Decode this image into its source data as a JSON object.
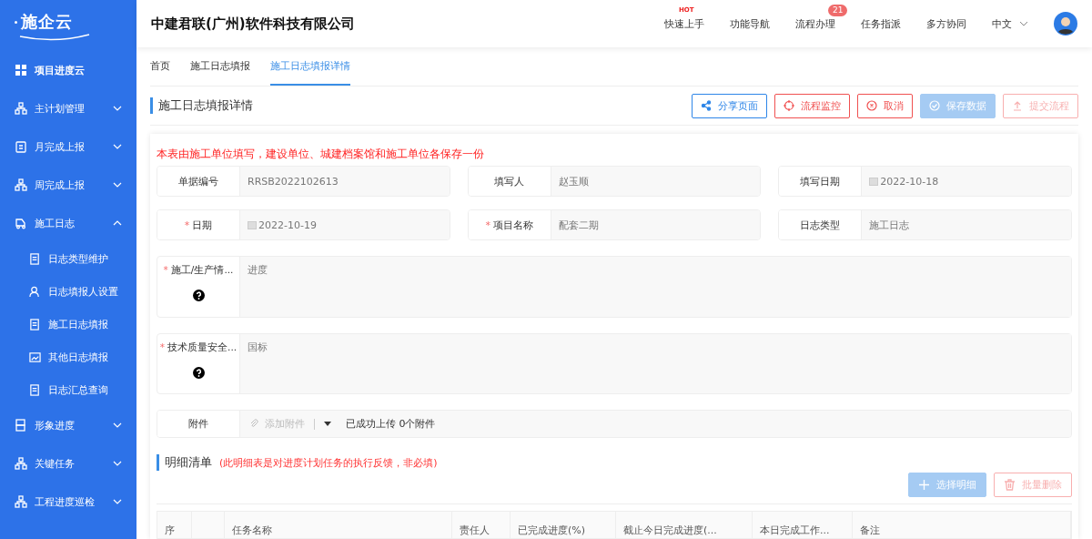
{
  "sidebar": {
    "logo": "施企云",
    "items": [
      {
        "label": "项目进度云"
      },
      {
        "label": "主计划管理",
        "expanded": false
      },
      {
        "label": "月完成上报",
        "expanded": false
      },
      {
        "label": "周完成上报",
        "expanded": false
      },
      {
        "label": "施工日志",
        "expanded": true,
        "children": [
          {
            "label": "日志类型维护"
          },
          {
            "label": "日志填报人设置"
          },
          {
            "label": "施工日志填报"
          },
          {
            "label": "其他日志填报"
          },
          {
            "label": "日志汇总查询"
          }
        ]
      },
      {
        "label": "形象进度",
        "expanded": false
      },
      {
        "label": "关键任务",
        "expanded": false
      },
      {
        "label": "工程进度巡检",
        "expanded": false
      }
    ]
  },
  "header": {
    "company": "中建君联(广州)软件科技有限公司",
    "nav": [
      {
        "label": "快速上手",
        "badge": "HOT"
      },
      {
        "label": "功能导航"
      },
      {
        "label": "流程办理",
        "badge": "21"
      },
      {
        "label": "任务指派"
      },
      {
        "label": "多方协同"
      }
    ],
    "language": "中文"
  },
  "tabs": [
    {
      "label": "首页",
      "selected": false
    },
    {
      "label": "施工日志填报",
      "selected": false
    },
    {
      "label": "施工日志填报详情",
      "selected": true
    }
  ],
  "page_title": "施工日志填报详情",
  "actions": [
    {
      "label": "分享页面",
      "kind": "primary",
      "disabled": false
    },
    {
      "label": "流程监控",
      "kind": "danger",
      "disabled": false
    },
    {
      "label": "取消",
      "kind": "danger",
      "disabled": false
    },
    {
      "label": "保存数据",
      "kind": "primary-filled",
      "disabled": true
    },
    {
      "label": "提交流程",
      "kind": "danger",
      "disabled": true
    }
  ],
  "notice": "本表由施工单位填写，建设单位、城建档案馆和施工单位各保存一份",
  "required_mark": "*",
  "fields": [
    {
      "label": "单据编号",
      "value": "RRSB2022102613",
      "required": false,
      "kind": "text"
    },
    {
      "label": "填写人",
      "value": "赵玉顺",
      "required": false,
      "kind": "text"
    },
    {
      "label": "填写日期",
      "value": "2022-10-18",
      "required": false,
      "kind": "date"
    },
    {
      "label": "日期",
      "value": "2022-10-19",
      "required": true,
      "kind": "date"
    },
    {
      "label": "项目名称",
      "value": "配套二期",
      "required": true,
      "kind": "text"
    },
    {
      "label": "日志类型",
      "value": "施工日志",
      "required": false,
      "kind": "text"
    }
  ],
  "text_areas": [
    {
      "label": "施工/生产情...",
      "value": "进度",
      "required": true
    },
    {
      "label": "技术质量安全...",
      "value": "国标",
      "required": true
    }
  ],
  "attachment": {
    "label": "附件",
    "button": "添加附件",
    "status": "已成功上传 0个附件"
  },
  "detail": {
    "title": "明细清单",
    "note": "(此明细表是对进度计划任务的执行反馈，非必填)",
    "actions": [
      {
        "label": "选择明细",
        "kind": "primary-filled",
        "disabled": true
      },
      {
        "label": "批量删除",
        "kind": "danger",
        "disabled": true
      }
    ],
    "columns": [
      "序",
      "",
      "任务名称",
      "责任人",
      "已完成进度(%)",
      "截止今日完成进度(...",
      "本日完成工作...",
      "备注"
    ]
  }
}
